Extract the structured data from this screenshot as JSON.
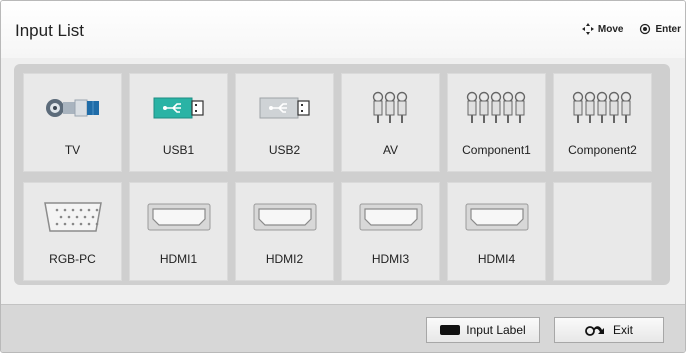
{
  "header": {
    "title": "Input List",
    "hints": [
      {
        "icon": "dpad-arrows-icon",
        "label": "Move"
      },
      {
        "icon": "ok-button-icon",
        "label": "Enter"
      }
    ]
  },
  "inputs": [
    {
      "label": "TV",
      "icon": "coax-antenna-icon"
    },
    {
      "label": "USB1",
      "icon": "usb-active-icon"
    },
    {
      "label": "USB2",
      "icon": "usb-icon"
    },
    {
      "label": "AV",
      "icon": "av-rca-icon"
    },
    {
      "label": "Component1",
      "icon": "component-rca-icon"
    },
    {
      "label": "Component2",
      "icon": "component-rca-icon"
    },
    {
      "label": "RGB-PC",
      "icon": "vga-connector-icon"
    },
    {
      "label": "HDMI1",
      "icon": "hdmi-port-icon"
    },
    {
      "label": "HDMI2",
      "icon": "hdmi-port-icon"
    },
    {
      "label": "HDMI3",
      "icon": "hdmi-port-icon"
    },
    {
      "label": "HDMI4",
      "icon": "hdmi-port-icon"
    }
  ],
  "footer": {
    "input_label": "Input Label",
    "exit": "Exit"
  },
  "colors": {
    "usb_active": "#2ab3a5",
    "panel": "#cfcfcf",
    "tile": "#e9e9e9"
  }
}
